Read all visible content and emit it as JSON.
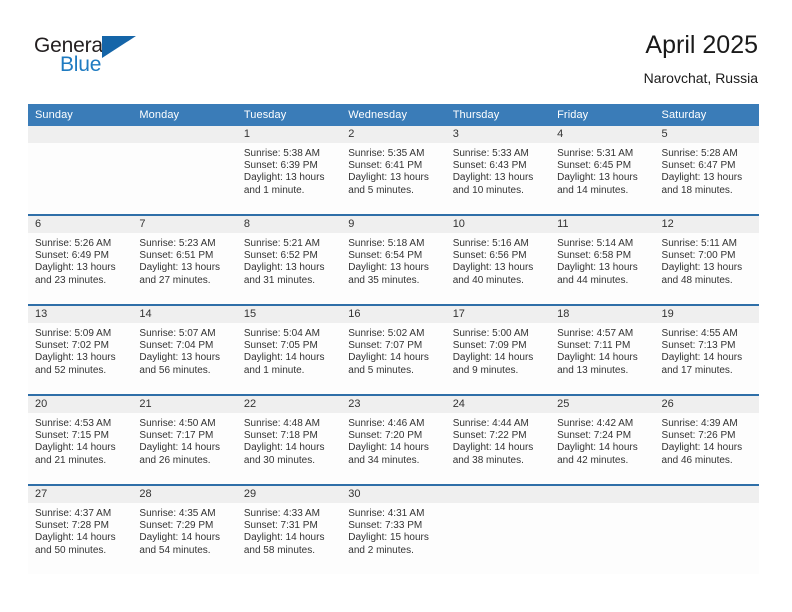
{
  "brand": {
    "name_part1": "General",
    "name_part2": "Blue",
    "triangle_icon": "triangle-icon",
    "accent_color": "#1f7bc1",
    "triangle_color": "#1565a8"
  },
  "header": {
    "title": "April 2025",
    "subtitle": "Narovchat, Russia"
  },
  "theme": {
    "header_blue": "#3a7cb8",
    "row_divider_blue": "#2f6fa8",
    "daynum_band_gray": "#efefef",
    "cell_background": "#fdfdfd",
    "text_color": "#333333"
  },
  "weekday_headers": [
    "Sunday",
    "Monday",
    "Tuesday",
    "Wednesday",
    "Thursday",
    "Friday",
    "Saturday"
  ],
  "weeks": [
    [
      {
        "day": "",
        "sunrise": "",
        "sunset": "",
        "daylight_line1": "",
        "daylight_line2": ""
      },
      {
        "day": "",
        "sunrise": "",
        "sunset": "",
        "daylight_line1": "",
        "daylight_line2": ""
      },
      {
        "day": "1",
        "sunrise": "Sunrise: 5:38 AM",
        "sunset": "Sunset: 6:39 PM",
        "daylight_line1": "Daylight: 13 hours",
        "daylight_line2": "and 1 minute."
      },
      {
        "day": "2",
        "sunrise": "Sunrise: 5:35 AM",
        "sunset": "Sunset: 6:41 PM",
        "daylight_line1": "Daylight: 13 hours",
        "daylight_line2": "and 5 minutes."
      },
      {
        "day": "3",
        "sunrise": "Sunrise: 5:33 AM",
        "sunset": "Sunset: 6:43 PM",
        "daylight_line1": "Daylight: 13 hours",
        "daylight_line2": "and 10 minutes."
      },
      {
        "day": "4",
        "sunrise": "Sunrise: 5:31 AM",
        "sunset": "Sunset: 6:45 PM",
        "daylight_line1": "Daylight: 13 hours",
        "daylight_line2": "and 14 minutes."
      },
      {
        "day": "5",
        "sunrise": "Sunrise: 5:28 AM",
        "sunset": "Sunset: 6:47 PM",
        "daylight_line1": "Daylight: 13 hours",
        "daylight_line2": "and 18 minutes."
      }
    ],
    [
      {
        "day": "6",
        "sunrise": "Sunrise: 5:26 AM",
        "sunset": "Sunset: 6:49 PM",
        "daylight_line1": "Daylight: 13 hours",
        "daylight_line2": "and 23 minutes."
      },
      {
        "day": "7",
        "sunrise": "Sunrise: 5:23 AM",
        "sunset": "Sunset: 6:51 PM",
        "daylight_line1": "Daylight: 13 hours",
        "daylight_line2": "and 27 minutes."
      },
      {
        "day": "8",
        "sunrise": "Sunrise: 5:21 AM",
        "sunset": "Sunset: 6:52 PM",
        "daylight_line1": "Daylight: 13 hours",
        "daylight_line2": "and 31 minutes."
      },
      {
        "day": "9",
        "sunrise": "Sunrise: 5:18 AM",
        "sunset": "Sunset: 6:54 PM",
        "daylight_line1": "Daylight: 13 hours",
        "daylight_line2": "and 35 minutes."
      },
      {
        "day": "10",
        "sunrise": "Sunrise: 5:16 AM",
        "sunset": "Sunset: 6:56 PM",
        "daylight_line1": "Daylight: 13 hours",
        "daylight_line2": "and 40 minutes."
      },
      {
        "day": "11",
        "sunrise": "Sunrise: 5:14 AM",
        "sunset": "Sunset: 6:58 PM",
        "daylight_line1": "Daylight: 13 hours",
        "daylight_line2": "and 44 minutes."
      },
      {
        "day": "12",
        "sunrise": "Sunrise: 5:11 AM",
        "sunset": "Sunset: 7:00 PM",
        "daylight_line1": "Daylight: 13 hours",
        "daylight_line2": "and 48 minutes."
      }
    ],
    [
      {
        "day": "13",
        "sunrise": "Sunrise: 5:09 AM",
        "sunset": "Sunset: 7:02 PM",
        "daylight_line1": "Daylight: 13 hours",
        "daylight_line2": "and 52 minutes."
      },
      {
        "day": "14",
        "sunrise": "Sunrise: 5:07 AM",
        "sunset": "Sunset: 7:04 PM",
        "daylight_line1": "Daylight: 13 hours",
        "daylight_line2": "and 56 minutes."
      },
      {
        "day": "15",
        "sunrise": "Sunrise: 5:04 AM",
        "sunset": "Sunset: 7:05 PM",
        "daylight_line1": "Daylight: 14 hours",
        "daylight_line2": "and 1 minute."
      },
      {
        "day": "16",
        "sunrise": "Sunrise: 5:02 AM",
        "sunset": "Sunset: 7:07 PM",
        "daylight_line1": "Daylight: 14 hours",
        "daylight_line2": "and 5 minutes."
      },
      {
        "day": "17",
        "sunrise": "Sunrise: 5:00 AM",
        "sunset": "Sunset: 7:09 PM",
        "daylight_line1": "Daylight: 14 hours",
        "daylight_line2": "and 9 minutes."
      },
      {
        "day": "18",
        "sunrise": "Sunrise: 4:57 AM",
        "sunset": "Sunset: 7:11 PM",
        "daylight_line1": "Daylight: 14 hours",
        "daylight_line2": "and 13 minutes."
      },
      {
        "day": "19",
        "sunrise": "Sunrise: 4:55 AM",
        "sunset": "Sunset: 7:13 PM",
        "daylight_line1": "Daylight: 14 hours",
        "daylight_line2": "and 17 minutes."
      }
    ],
    [
      {
        "day": "20",
        "sunrise": "Sunrise: 4:53 AM",
        "sunset": "Sunset: 7:15 PM",
        "daylight_line1": "Daylight: 14 hours",
        "daylight_line2": "and 21 minutes."
      },
      {
        "day": "21",
        "sunrise": "Sunrise: 4:50 AM",
        "sunset": "Sunset: 7:17 PM",
        "daylight_line1": "Daylight: 14 hours",
        "daylight_line2": "and 26 minutes."
      },
      {
        "day": "22",
        "sunrise": "Sunrise: 4:48 AM",
        "sunset": "Sunset: 7:18 PM",
        "daylight_line1": "Daylight: 14 hours",
        "daylight_line2": "and 30 minutes."
      },
      {
        "day": "23",
        "sunrise": "Sunrise: 4:46 AM",
        "sunset": "Sunset: 7:20 PM",
        "daylight_line1": "Daylight: 14 hours",
        "daylight_line2": "and 34 minutes."
      },
      {
        "day": "24",
        "sunrise": "Sunrise: 4:44 AM",
        "sunset": "Sunset: 7:22 PM",
        "daylight_line1": "Daylight: 14 hours",
        "daylight_line2": "and 38 minutes."
      },
      {
        "day": "25",
        "sunrise": "Sunrise: 4:42 AM",
        "sunset": "Sunset: 7:24 PM",
        "daylight_line1": "Daylight: 14 hours",
        "daylight_line2": "and 42 minutes."
      },
      {
        "day": "26",
        "sunrise": "Sunrise: 4:39 AM",
        "sunset": "Sunset: 7:26 PM",
        "daylight_line1": "Daylight: 14 hours",
        "daylight_line2": "and 46 minutes."
      }
    ],
    [
      {
        "day": "27",
        "sunrise": "Sunrise: 4:37 AM",
        "sunset": "Sunset: 7:28 PM",
        "daylight_line1": "Daylight: 14 hours",
        "daylight_line2": "and 50 minutes."
      },
      {
        "day": "28",
        "sunrise": "Sunrise: 4:35 AM",
        "sunset": "Sunset: 7:29 PM",
        "daylight_line1": "Daylight: 14 hours",
        "daylight_line2": "and 54 minutes."
      },
      {
        "day": "29",
        "sunrise": "Sunrise: 4:33 AM",
        "sunset": "Sunset: 7:31 PM",
        "daylight_line1": "Daylight: 14 hours",
        "daylight_line2": "and 58 minutes."
      },
      {
        "day": "30",
        "sunrise": "Sunrise: 4:31 AM",
        "sunset": "Sunset: 7:33 PM",
        "daylight_line1": "Daylight: 15 hours",
        "daylight_line2": "and 2 minutes."
      },
      {
        "day": "",
        "sunrise": "",
        "sunset": "",
        "daylight_line1": "",
        "daylight_line2": ""
      },
      {
        "day": "",
        "sunrise": "",
        "sunset": "",
        "daylight_line1": "",
        "daylight_line2": ""
      },
      {
        "day": "",
        "sunrise": "",
        "sunset": "",
        "daylight_line1": "",
        "daylight_line2": ""
      }
    ]
  ]
}
